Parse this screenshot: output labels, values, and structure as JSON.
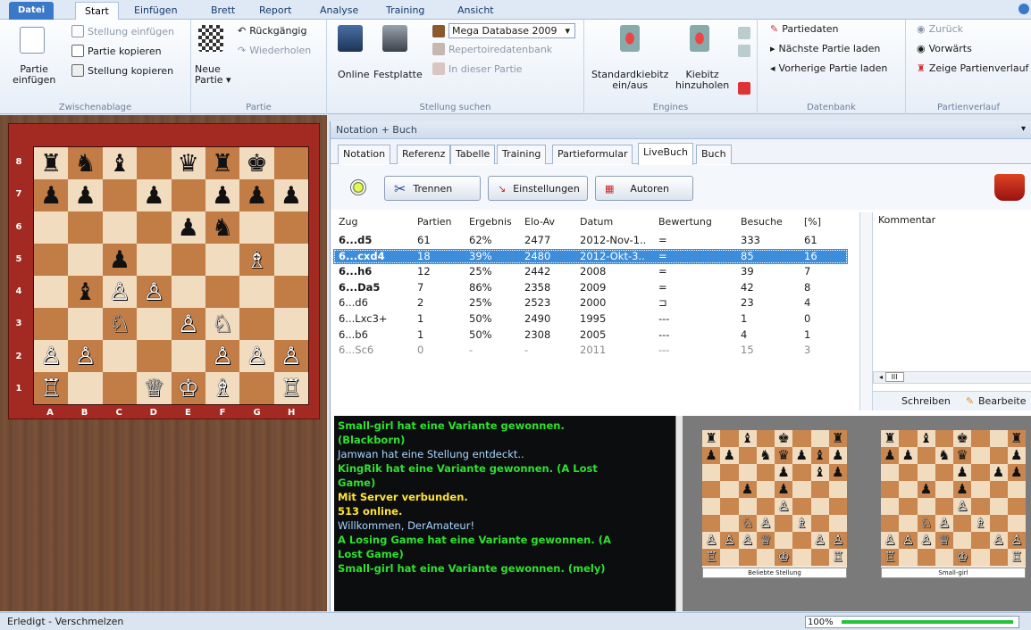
{
  "ribbon": {
    "tabs": [
      "Datei",
      "Start",
      "Einfügen",
      "Brett",
      "Report",
      "Analyse",
      "Training",
      "Ansicht"
    ],
    "zw": {
      "paste": "Partie\neinfügen",
      "ins_pos": "Stellung einfügen",
      "copy_game": "Partie kopieren",
      "copy_pos": "Stellung kopieren",
      "label": "Zwischenablage"
    },
    "partie": {
      "new": "Neue\nPartie ▾",
      "undo": "Rückgängig",
      "redo": "Wiederholen",
      "label": "Partie"
    },
    "search": {
      "online": "Online",
      "disk": "Festplatte",
      "db": "Mega Database 2009",
      "rep": "Repertoiredatenbank",
      "this": "In dieser Partie",
      "label": "Stellung suchen"
    },
    "engines": {
      "std": "Standardkiebitz\nein/aus",
      "add": "Kiebitz\nhinzuholen",
      "label": "Engines"
    },
    "db": {
      "data": "Partiedaten",
      "next": "Nächste Partie laden",
      "prev": "Vorherige Partie laden",
      "label": "Datenbank"
    },
    "hist": {
      "back": "Zurück",
      "fwd": "Vorwärts",
      "show": "Zeige Partienverlauf",
      "label": "Partienverlauf"
    }
  },
  "board": {
    "ranks": [
      "8",
      "7",
      "6",
      "5",
      "4",
      "3",
      "2",
      "1"
    ],
    "files": [
      "A",
      "B",
      "C",
      "D",
      "E",
      "F",
      "G",
      "H"
    ],
    "position": [
      "rnb.qrk.",
      "pp.p.ppp",
      "....pn..",
      "..p...B.",
      ".bPP....",
      "..N.PN..",
      "PP...PPP",
      "R..QKB.R"
    ]
  },
  "panel": {
    "title": "Notation + Buch",
    "tabs": [
      "Notation",
      "Referenz",
      "Tabelle",
      "Training",
      "Partieformular",
      "LiveBuch",
      "Buch"
    ],
    "active_tab": "LiveBuch",
    "buttons": {
      "disconnect": "Trennen",
      "settings": "Einstellungen",
      "authors": "Autoren"
    },
    "columns": [
      "Zug",
      "Partien",
      "Ergebnis",
      "Elo-Av",
      "Datum",
      "Bewertung",
      "Besuche",
      "[%]"
    ],
    "rows": [
      [
        "6...d5",
        "61",
        "62%",
        "2477",
        "2012-Nov-1..",
        "=",
        "333",
        "61"
      ],
      [
        "6...cxd4",
        "18",
        "39%",
        "2480",
        "2012-Okt-3..",
        "=",
        "85",
        "16"
      ],
      [
        "6...h6",
        "12",
        "25%",
        "2442",
        "2008",
        "=",
        "39",
        "7"
      ],
      [
        "6...Da5",
        "7",
        "86%",
        "2358",
        "2009",
        "=",
        "42",
        "8"
      ],
      [
        "6...d6",
        "2",
        "25%",
        "2523",
        "2000",
        "⊐",
        "23",
        "4"
      ],
      [
        "6...Lxc3+",
        "1",
        "50%",
        "2490",
        "1995",
        "---",
        "1",
        "0"
      ],
      [
        "6...b6",
        "1",
        "50%",
        "2308",
        "2005",
        "---",
        "4",
        "1"
      ],
      [
        "6...Sc6",
        "0",
        "-",
        "-",
        "2011",
        "---",
        "15",
        "3"
      ]
    ],
    "bold_rows": [
      0,
      1,
      2,
      3
    ],
    "selected_row": 1,
    "comment_header": "Kommentar",
    "scroll_text": "III",
    "write": "Schreiben",
    "edit": "Bearbeite"
  },
  "chat": [
    {
      "t": "Small-girl hat eine Variante gewonnen.",
      "c": "cg"
    },
    {
      "t": "(Blackborn)",
      "c": "cg"
    },
    {
      "t": "Jamwan hat eine Stellung entdeckt..",
      "c": "cc"
    },
    {
      "t": "KingRik hat eine Variante gewonnen. (A Lost",
      "c": "cg"
    },
    {
      "t": "Game)",
      "c": "cg"
    },
    {
      "t": "Mit Server verbunden.",
      "c": "cy"
    },
    {
      "t": "513 online.",
      "c": "cy"
    },
    {
      "t": "Willkommen, DerAmateur!",
      "c": "cc"
    },
    {
      "t": "A Losing Game hat eine Variante gewonnen. (A",
      "c": "cg"
    },
    {
      "t": "Lost Game)",
      "c": "cg"
    },
    {
      "t": "Small-girl hat eine Variante gewonnen. (mely)",
      "c": "cg"
    }
  ],
  "thumbs": [
    {
      "caption": "Beliebte Stellung",
      "position": [
        "r.b.k..r",
        "pp.nqpbp",
        "....p.bp",
        "..p.p...",
        "....P...",
        "..NP.B..",
        "PPPQ..PP",
        "R...K..R"
      ]
    },
    {
      "caption": "Small-girl",
      "position": [
        "r.b.k..r",
        "pp.nq..p",
        "....p.pp",
        "..p.p...",
        "....P...",
        "..NP.B..",
        "PPPQ..PP",
        "R...K..R"
      ]
    }
  ],
  "status": {
    "text": "Erledigt - Verschmelzen",
    "progress_text": "100%",
    "progress": 1.0
  }
}
